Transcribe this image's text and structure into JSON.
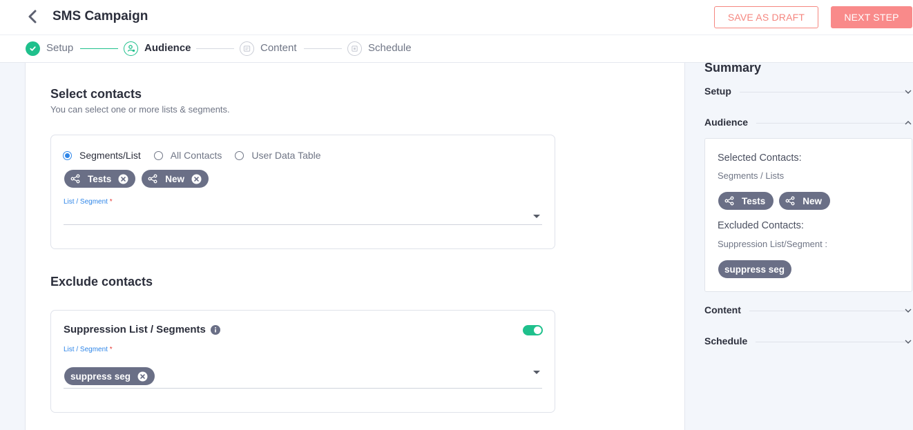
{
  "header": {
    "title": "SMS Campaign",
    "save_draft_label": "SAVE AS DRAFT",
    "next_step_label": "NEXT STEP"
  },
  "stepper": {
    "steps": [
      {
        "label": "Setup",
        "state": "completed"
      },
      {
        "label": "Audience",
        "state": "active"
      },
      {
        "label": "Content",
        "state": "pending"
      },
      {
        "label": "Schedule",
        "state": "pending"
      }
    ]
  },
  "select_contacts": {
    "title": "Select contacts",
    "subtitle": "You can select one or more lists & segments.",
    "options": [
      {
        "label": "Segments/List",
        "selected": true
      },
      {
        "label": "All Contacts",
        "selected": false
      },
      {
        "label": "User Data Table",
        "selected": false
      }
    ],
    "chips": [
      "Tests",
      "New"
    ],
    "field_label": "List / Segment",
    "required_mark": "*"
  },
  "exclude_contacts": {
    "title": "Exclude contacts",
    "suppression_title": "Suppression List / Segments",
    "toggle_on": true,
    "field_label": "List / Segment",
    "required_mark": "*",
    "chips": [
      "suppress seg"
    ]
  },
  "summary": {
    "title": "Summary",
    "sections": {
      "setup": "Setup",
      "audience": "Audience",
      "content": "Content",
      "schedule": "Schedule"
    },
    "selected_contacts_label": "Selected Contacts:",
    "selected_type": "Segments / Lists",
    "selected_chips": [
      "Tests",
      "New"
    ],
    "excluded_contacts_label": "Excluded Contacts:",
    "excluded_type": "Suppression List/Segment :",
    "excluded_chips": [
      "suppress seg"
    ]
  },
  "colors": {
    "accent_green": "#1fc08c",
    "accent_blue": "#2f86e8",
    "coral": "#f98a8a",
    "chip_bg": "#6a6f86"
  }
}
